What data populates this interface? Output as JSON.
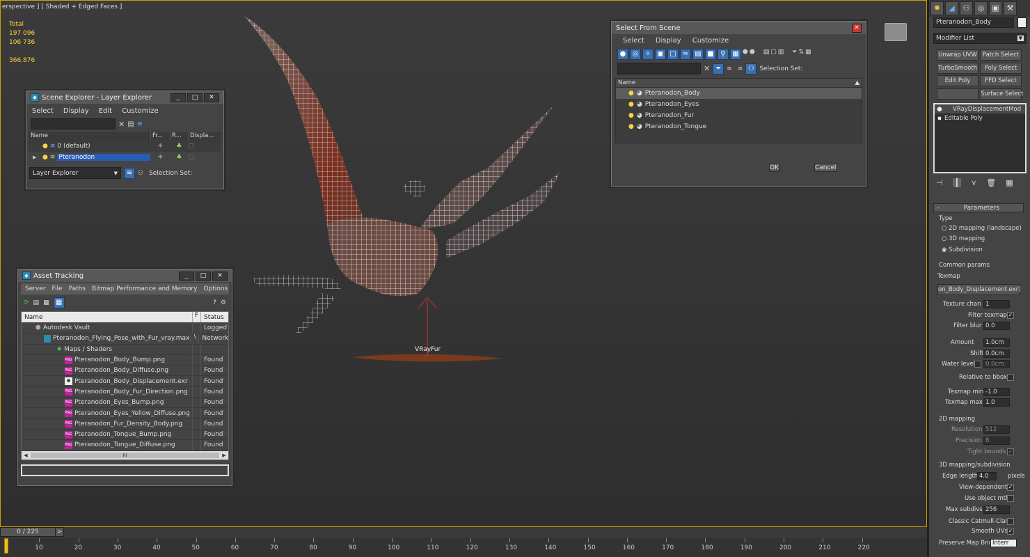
{
  "viewport": {
    "label": "erspective ] [ Shaded + Edged Faces ]",
    "stats": {
      "total_label": "Total",
      "polys": "197 096",
      "verts": "106 736",
      "fps": "366.876"
    },
    "object_label": "VRayFur"
  },
  "scene_explorer": {
    "title": "Scene Explorer - Layer Explorer",
    "menu": [
      "Select",
      "Display",
      "Edit",
      "Customize"
    ],
    "columns": [
      "Name",
      "Fr...",
      "R...",
      "Displa..."
    ],
    "rows": [
      "0 (default)",
      "Pteranodon"
    ],
    "footer_dropdown": "Layer Explorer",
    "selection_set": "Selection Set:"
  },
  "asset_tracking": {
    "title": "Asset Tracking",
    "menu": [
      "Server",
      "File",
      "Paths",
      "Bitmap Performance and Memory",
      "Options"
    ],
    "columns": [
      "Name",
      "F",
      "Status"
    ],
    "rows": [
      {
        "name": "Autodesk Vault",
        "f": "",
        "status": "Logged"
      },
      {
        "name": "Pteranodon_Flying_Pose_with_Fur_vray.max",
        "f": "\\",
        "status": "Network"
      },
      {
        "name": "Maps / Shaders",
        "f": "",
        "status": ""
      },
      {
        "name": "Pteranodon_Body_Bump.png",
        "f": "",
        "status": "Found"
      },
      {
        "name": "Pteranodon_Body_Diffuse.png",
        "f": "",
        "status": "Found"
      },
      {
        "name": "Pteranodon_Body_Displacement.exr",
        "f": "",
        "status": "Found"
      },
      {
        "name": "Pteranodon_Body_Fur_Direction.png",
        "f": "",
        "status": "Found"
      },
      {
        "name": "Pteranodon_Eyes_Bump.png",
        "f": "",
        "status": "Found"
      },
      {
        "name": "Pteranodon_Eyes_Yellow_Diffuse.png",
        "f": "",
        "status": "Found"
      },
      {
        "name": "Pteranodon_Fur_Density_Body.png",
        "f": "",
        "status": "Found"
      },
      {
        "name": "Pteranodon_Tongue_Bump.png",
        "f": "",
        "status": "Found"
      },
      {
        "name": "Pteranodon_Tongue_Diffuse.png",
        "f": "",
        "status": "Found"
      }
    ],
    "scroll_glyph": "III"
  },
  "select_from_scene": {
    "title": "Select From Scene",
    "menu": [
      "Select",
      "Display",
      "Customize"
    ],
    "selection_set": "Selection Set:",
    "column": "Name",
    "rows": [
      "Pteranodon_Body",
      "Pteranodon_Eyes",
      "Pteranodon_Fur",
      "Pteranodon_Tongue"
    ],
    "ok": "OK",
    "cancel": "Cancel"
  },
  "command_panel": {
    "object_name": "Pteranodon_Body",
    "modifier_list": "Modifier List",
    "buttons": [
      "Unwrap UVW",
      "Patch Select",
      "TurboSmooth",
      "Poly Select",
      "Edit Poly",
      "FFD Select",
      "",
      "Surface Select"
    ],
    "stack": [
      "VRayDisplacementMod",
      "Editable Poly"
    ],
    "rollout": "Parameters",
    "type_label": "Type",
    "types": [
      "2D mapping (landscape)",
      "3D mapping",
      "Subdivision"
    ],
    "common_params": "Common params",
    "texmap_label": "Texmap",
    "texmap_value": "on_Body_Displacement.exr)",
    "texture_chan": {
      "label": "Texture chan",
      "value": "1"
    },
    "filter_texmap": "Filter texmap",
    "filter_blur": {
      "label": "Filter blur",
      "value": "0.0"
    },
    "amount": {
      "label": "Amount",
      "value": "1.0cm"
    },
    "shift": {
      "label": "Shift",
      "value": "0.0cm"
    },
    "water_level": {
      "label": "Water level",
      "value": "0.0cm"
    },
    "relative_bbox": "Relative to bbox",
    "texmap_min": {
      "label": "Texmap min",
      "value": "-1.0"
    },
    "texmap_max": {
      "label": "Texmap max",
      "value": "1.0"
    },
    "mapping2d": "2D mapping",
    "resolution": {
      "label": "Resolution",
      "value": "512"
    },
    "precision": {
      "label": "Precision",
      "value": "8"
    },
    "tight_bounds": "Tight bounds",
    "mapping3d": "3D mapping/subdivision",
    "edge_length": {
      "label": "Edge length",
      "value": "4.0",
      "unit": "pixels"
    },
    "view_dependent": "View-dependent",
    "use_object_mtl": "Use object mtl",
    "max_subdivs": {
      "label": "Max subdivs",
      "value": "256"
    },
    "classic_catmull": "Classic Catmull-Clark",
    "smooth_uvs": "Smooth UVs",
    "preserve_map_bnd": {
      "label": "Preserve Map Bnd",
      "value": "Interr"
    }
  },
  "timeline": {
    "frame": "0 / 225",
    "next": ">",
    "ticks": [
      "10",
      "20",
      "30",
      "40",
      "50",
      "60",
      "70",
      "80",
      "90",
      "100",
      "110",
      "120",
      "130",
      "140",
      "150",
      "160",
      "170",
      "180",
      "190",
      "200",
      "210",
      "220"
    ]
  }
}
